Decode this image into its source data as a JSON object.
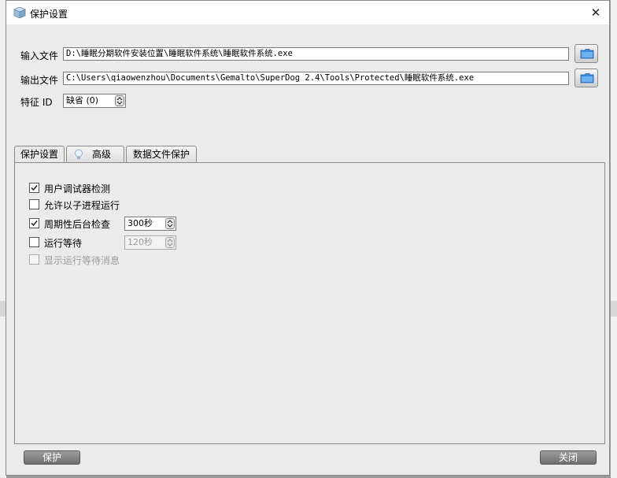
{
  "window": {
    "title": "保护设置",
    "close_glyph": "✕"
  },
  "form": {
    "input_label": "输入文件",
    "input_value": "D:\\睡眠分期软件安装位置\\睡眠软件系统\\睡眠软件系统.exe",
    "output_label": "输出文件",
    "output_value": "C:\\Users\\qiaowenzhou\\Documents\\Gemalto\\SuperDog 2.4\\Tools\\Protected\\睡眠软件系统.exe",
    "feature_label": "特征 ID",
    "feature_value": "缺省 (0)"
  },
  "tabs": [
    {
      "label": "保护设置",
      "active": true
    },
    {
      "label": "高级",
      "icon": "lightbulb-icon"
    },
    {
      "label": "数据文件保护"
    }
  ],
  "options": [
    {
      "label": "用户调试器检测",
      "checked": true,
      "enabled": true
    },
    {
      "label": "允许以子进程运行",
      "checked": false,
      "enabled": true
    },
    {
      "label": "周期性后台检查",
      "checked": true,
      "enabled": true,
      "spinner": "300秒"
    },
    {
      "label": "运行等待",
      "checked": false,
      "enabled": true,
      "spinner": "120秒",
      "spinner_disabled": true
    },
    {
      "label": "显示运行等待消息",
      "checked": false,
      "enabled": false
    }
  ],
  "buttons": {
    "protect": "保护",
    "close": "关闭"
  },
  "colors": {
    "dialog_bg": "#ebebeb",
    "titlebar_bg": "#ffffff",
    "folder_icon": "#2f7fd6",
    "bottom_button": "#7d7d7d"
  }
}
